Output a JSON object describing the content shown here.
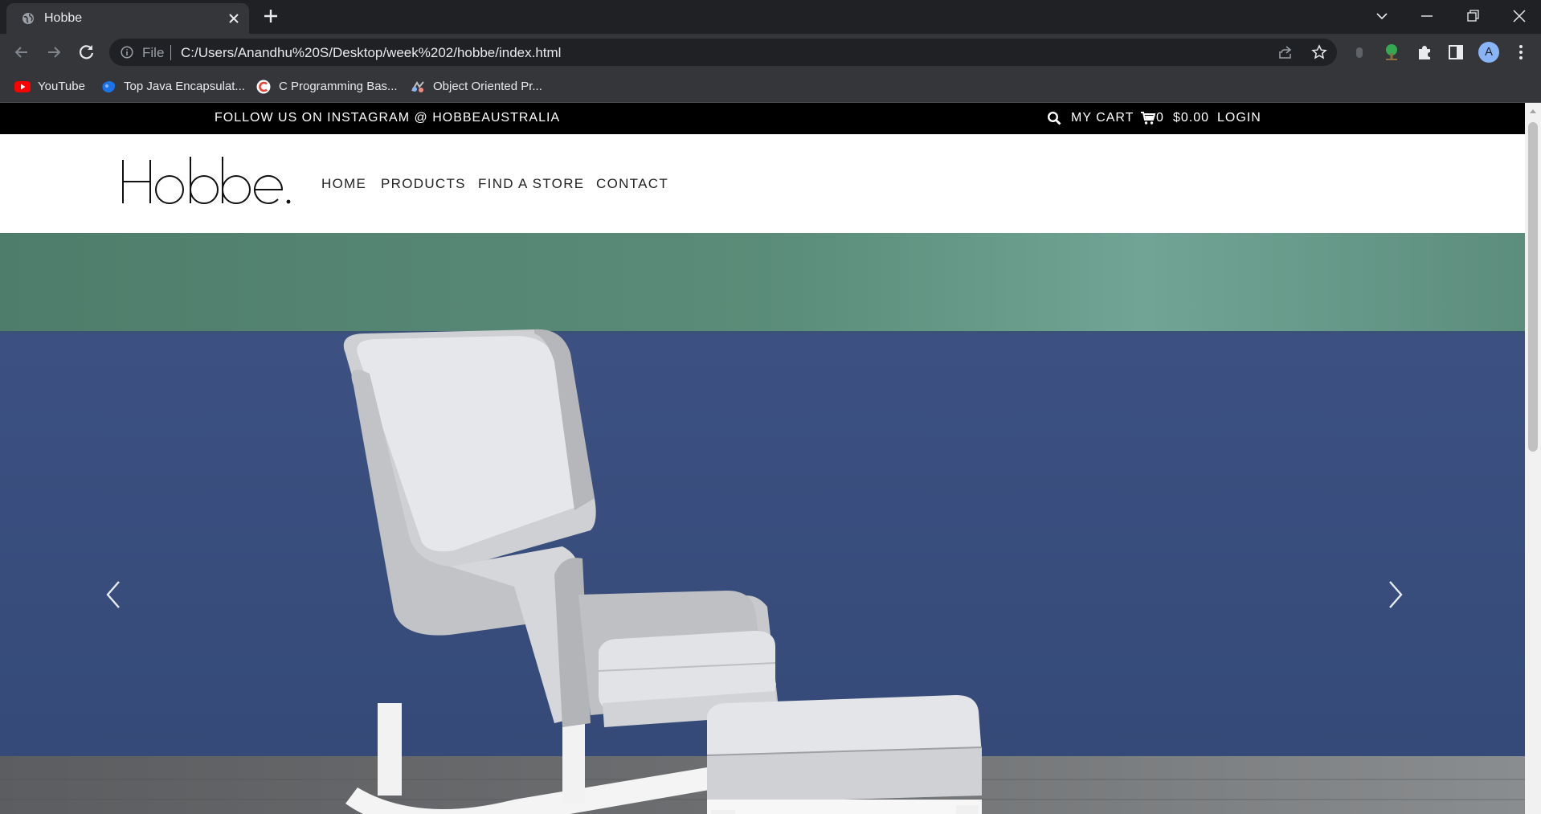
{
  "browser": {
    "tab_title": "Hobbe",
    "address_scheme": "File",
    "url": "C:/Users/Anandhu%20S/Desktop/week%202/hobbe/index.html",
    "avatar_letter": "A",
    "bookmarks": [
      {
        "label": "YouTube",
        "icon": "youtube-icon"
      },
      {
        "label": "Top Java Encapsulat...",
        "icon": "java-icon"
      },
      {
        "label": "C Programming Bas...",
        "icon": "c-icon"
      },
      {
        "label": "Object Oriented Pr...",
        "icon": "oop-icon"
      }
    ]
  },
  "site": {
    "topbar": {
      "instagram": "FOLLOW US ON INSTAGRAM @ HOBBEAUSTRALIA",
      "my_cart": "MY CART",
      "cart_count": "0",
      "cart_total": "$0.00",
      "login": "LOGIN"
    },
    "brand": "Hobbe.",
    "nav": [
      "HOME",
      "PRODUCTS",
      "FIND A STORE",
      "CONTACT"
    ],
    "hero": {
      "prev_icon": "chevron-left-icon",
      "next_icon": "chevron-right-icon"
    }
  },
  "colors": {
    "topbar_bg": "#000000",
    "hero_wall_blue": "#3b4f7c",
    "hero_wall_green": "#5d8c7a",
    "chrome_dark": "#202124",
    "chrome_mid": "#35363a"
  }
}
